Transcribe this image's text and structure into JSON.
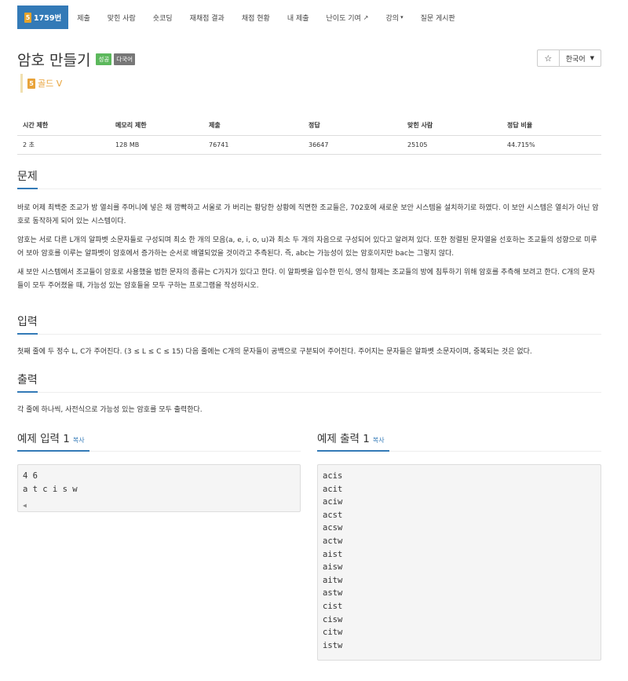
{
  "nav": {
    "brand_icon": "5",
    "brand_label": "1759번",
    "items": [
      "제출",
      "맞힌 사람",
      "숏코딩",
      "재채점 결과",
      "채점 현황",
      "내 제출",
      "난이도 기여",
      "강의",
      "질문 게시판"
    ]
  },
  "problem": {
    "title": "암호 만들기",
    "badge_success": "성공",
    "badge_lang": "다국어",
    "tier_icon": "5",
    "tier_label": "골드 V"
  },
  "tools": {
    "star": "☆",
    "language": "한국어"
  },
  "stats": {
    "headers": [
      "시간 제한",
      "메모리 제한",
      "제출",
      "정답",
      "맞힌 사람",
      "정답 비율"
    ],
    "values": [
      "2 초",
      "128 MB",
      "76741",
      "36647",
      "25105",
      "44.715%"
    ]
  },
  "sections": {
    "problem_title": "문제",
    "problem_paras": [
      "바로 어제 최백준 조교가 방 열쇠를 주머니에 넣은 채 깜빡하고 서울로 가 버리는 황당한 상황에 직면한 조교들은, 702호에 새로운 보안 시스템을 설치하기로 하였다. 이 보안 시스템은 열쇠가 아닌 암호로 동작하게 되어 있는 시스템이다.",
      "암호는 서로 다른 L개의 알파벳 소문자들로 구성되며 최소 한 개의 모음(a, e, i, o, u)과 최소 두 개의 자음으로 구성되어 있다고 알려져 있다. 또한 정렬된 문자열을 선호하는 조교들의 성향으로 미루어 보아 암호를 이루는 알파벳이 암호에서 증가하는 순서로 배열되었을 것이라고 추측된다. 즉, abc는 가능성이 있는 암호이지만 bac는 그렇지 않다.",
      "새 보안 시스템에서 조교들이 암호로 사용했을 법한 문자의 종류는 C가지가 있다고 한다. 이 알파벳을 입수한 민식, 영식 형제는 조교들의 방에 침투하기 위해 암호를 추측해 보려고 한다. C개의 문자들이 모두 주어졌을 때, 가능성 있는 암호들을 모두 구하는 프로그램을 작성하시오."
    ],
    "input_title": "입력",
    "input_para": "첫째 줄에 두 정수 L, C가 주어진다. (3 ≤ L ≤ C ≤ 15) 다음 줄에는 C개의 문자들이 공백으로 구분되어 주어진다. 주어지는 문자들은 알파벳 소문자이며, 중복되는 것은 없다.",
    "output_title": "출력",
    "output_para": "각 줄에 하나씩, 사전식으로 가능성 있는 암호를 모두 출력한다."
  },
  "examples": {
    "input_title": "예제 입력 1",
    "output_title": "예제 출력 1",
    "copy_label": "복사",
    "input_lines": [
      "4 6",
      "a t c i s w"
    ],
    "output_lines": [
      "acis",
      "acit",
      "aciw",
      "acst",
      "acsw",
      "actw",
      "aist",
      "aisw",
      "aitw",
      "astw",
      "cist",
      "cisw",
      "citw",
      "istw"
    ]
  },
  "colors": {
    "brand": "#337ab7",
    "success": "#5cb85c",
    "gold": "#e8a33a"
  }
}
